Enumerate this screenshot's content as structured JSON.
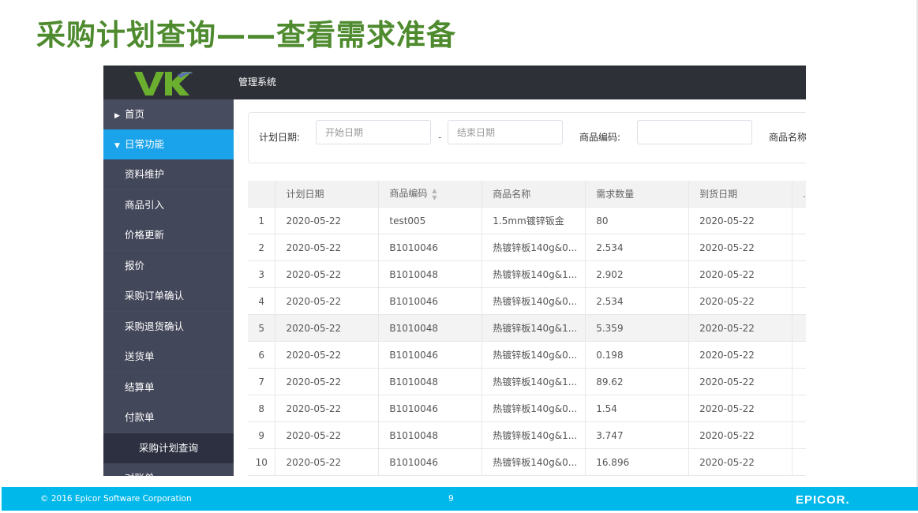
{
  "slide": {
    "title": "采购计划查询——查看需求准备",
    "footer": {
      "copyright": "© 2016 Epicor Software Corporation",
      "page_number": "9",
      "brand": "EPICOR."
    }
  },
  "app": {
    "title": "管理系统",
    "logo_text": "VK",
    "colors": {
      "topbar": "#2e3038",
      "sidebar": "#484c5f",
      "accent": "#1aa3ea",
      "logo": "#6aaf2e"
    }
  },
  "sidebar": {
    "items": [
      {
        "label": "首页",
        "icon": "caret-right-icon",
        "glyph": "▶"
      },
      {
        "label": "日常功能",
        "icon": "caret-down-icon",
        "glyph": "▼"
      },
      {
        "label": "资料维护"
      },
      {
        "label": "商品引入"
      },
      {
        "label": "价格更新"
      },
      {
        "label": "报价"
      },
      {
        "label": "采购订单确认"
      },
      {
        "label": "采购退货确认"
      },
      {
        "label": "送货单"
      },
      {
        "label": "结算单"
      },
      {
        "label": "付款单"
      },
      {
        "label": "采购计划查询"
      },
      {
        "label": "对账单"
      }
    ]
  },
  "filters": {
    "plan_date_label": "计划日期:",
    "start_placeholder": "开始日期",
    "separator": "-",
    "end_placeholder": "结束日期",
    "code_label": "商品编码:",
    "code_value": "",
    "name_label": "商品名称"
  },
  "table": {
    "columns": [
      "",
      "计划日期",
      "商品编码",
      "商品名称",
      "需求数量",
      "到货日期",
      "..."
    ],
    "sort_icon": "sort-icon",
    "rows": [
      [
        "1",
        "2020-05-22",
        "test005",
        "1.5mm镀锌钣金",
        "80",
        "2020-05-22"
      ],
      [
        "2",
        "2020-05-22",
        "B1010046",
        "热镀锌板140g&0...",
        "2.534",
        "2020-05-22"
      ],
      [
        "3",
        "2020-05-22",
        "B1010048",
        "热镀锌板140g&1...",
        "2.902",
        "2020-05-22"
      ],
      [
        "4",
        "2020-05-22",
        "B1010046",
        "热镀锌板140g&0...",
        "2.534",
        "2020-05-22"
      ],
      [
        "5",
        "2020-05-22",
        "B1010048",
        "热镀锌板140g&1...",
        "5.359",
        "2020-05-22"
      ],
      [
        "6",
        "2020-05-22",
        "B1010046",
        "热镀锌板140g&0...",
        "0.198",
        "2020-05-22"
      ],
      [
        "7",
        "2020-05-22",
        "B1010048",
        "热镀锌板140g&1...",
        "89.62",
        "2020-05-22"
      ],
      [
        "8",
        "2020-05-22",
        "B1010046",
        "热镀锌板140g&0...",
        "1.54",
        "2020-05-22"
      ],
      [
        "9",
        "2020-05-22",
        "B1010048",
        "热镀锌板140g&1...",
        "3.747",
        "2020-05-22"
      ],
      [
        "10",
        "2020-05-22",
        "B1010046",
        "热镀锌板140g&0...",
        "16.896",
        "2020-05-22"
      ]
    ]
  }
}
